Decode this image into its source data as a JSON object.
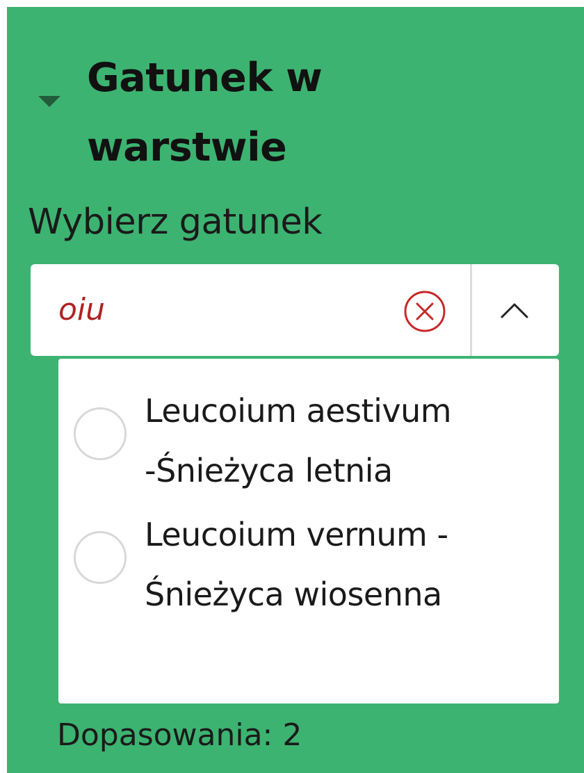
{
  "section": {
    "title": "Gatunek w\nwarstwie",
    "expanded": true
  },
  "field": {
    "label": "Wybierz gatunek"
  },
  "combobox": {
    "value": "oiu",
    "clear_icon": "circle-x-icon",
    "toggle_icon": "chevron-up-icon"
  },
  "options": [
    {
      "label": "Leucoium aestivum\n-Śnieżyca letnia",
      "selected": false
    },
    {
      "label": "Leucoium vernum -\nŚnieżyca wiosenna",
      "selected": false
    }
  ],
  "status": {
    "matches_text": "Dopasowania: 2"
  },
  "colors": {
    "panel_background": "#3db371",
    "search_text": "#b02222",
    "clear_icon": "#c62828"
  }
}
